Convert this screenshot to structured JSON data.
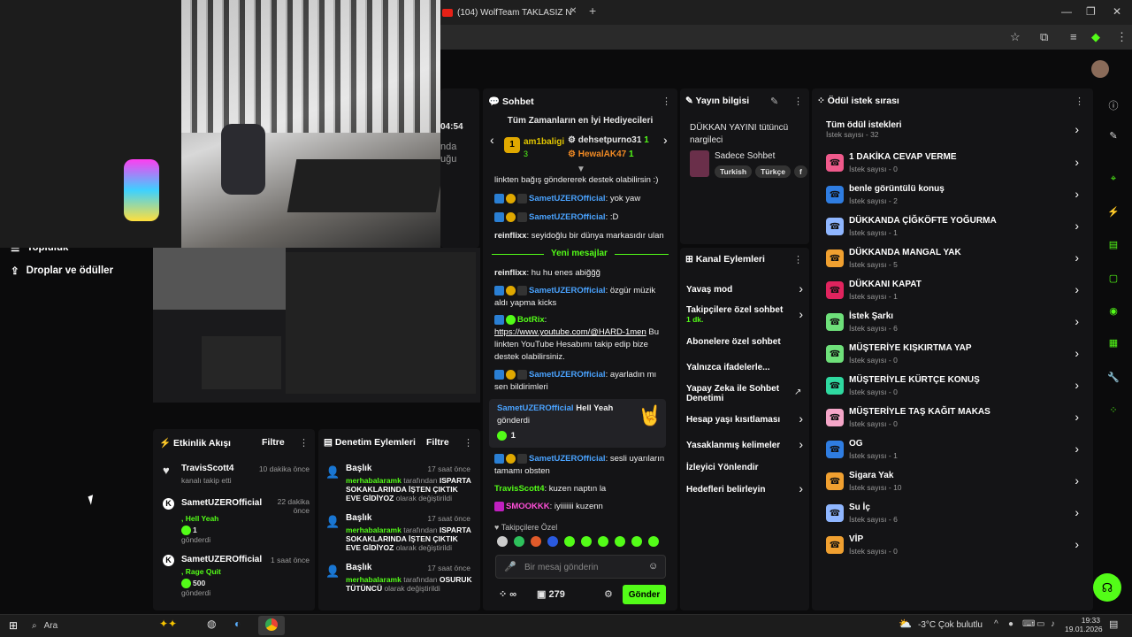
{
  "browser": {
    "tab_title": "(104) WolfTeam TAKLASIZ N",
    "new_tab": "+",
    "close": "✕"
  },
  "left_nav": {
    "items": [
      {
        "label": "Topluluk"
      },
      {
        "label": "Droplar ve ödüller"
      }
    ]
  },
  "partial_panel": {
    "time": "04:54",
    "line1": "nda",
    "line2": "uğu"
  },
  "chat": {
    "title": "Sohbet",
    "leaderboard_title": "Tüm Zamanların en İyi Hediyecileri",
    "leaders": [
      {
        "name": "am1baligi",
        "count": "3"
      },
      {
        "name": "dehsetpurno31",
        "count": "1"
      },
      {
        "name": "HewalAK47",
        "count": "1"
      }
    ],
    "messages_top": [
      {
        "text": "linkten bağış göndererek destek olabilirsin :)"
      },
      {
        "user": "SametUZEROfficial",
        "text": ": yok yaw"
      },
      {
        "user": "SametUZEROfficial",
        "text": ": :D"
      },
      {
        "user": "reinflixx",
        "text": ": seyidoğlu bir dünya markasıdır ulan"
      }
    ],
    "new_messages": "Yeni mesajlar",
    "messages_bottom": [
      {
        "user": "reinflixx",
        "text": ": hu hu enes abiğğğ"
      },
      {
        "user": "SametUZEROfficial",
        "text": ": özgür müzik aldı yapma kicks"
      },
      {
        "user": "BotRix",
        "text": ":"
      },
      {
        "link": "https://www.youtube.com/@HARD-1men",
        "text": " Bu linkten YouTube Hesabımı takip edip bize destek olabilirsiniz."
      },
      {
        "user": "SametUZEROfficial",
        "text": ": ayarladın mı sen bildirimleri"
      }
    ],
    "gift": {
      "user": "SametUZEROfficial",
      "item": "Hell Yeah",
      "sent": "gönderdi",
      "amount": "1"
    },
    "messages_after": [
      {
        "user": "SametUZEROfficial",
        "text": ": sesli uyarıların tamamı obsten"
      },
      {
        "user": "TravisScott4",
        "text": ": kuzen naptın la"
      },
      {
        "user": "SMOOKKK",
        "text": ": iyiiiiiii kuzenn"
      }
    ],
    "followers_only": "Takipçilere Özel",
    "input_placeholder": "Bir mesaj gönderin",
    "viewers": "279",
    "send": "Gönder",
    "infinity": "∞"
  },
  "stream_info": {
    "title": "Yayın bilgisi",
    "stream_title": "DÜKKAN YAYINI tütüncü nargileci",
    "category": "Sadece Sohbet",
    "tags": [
      "Turkish",
      "Türkçe",
      "f"
    ]
  },
  "channel_actions": {
    "title": "Kanal Eylemleri",
    "items": [
      {
        "label": "Yavaş mod",
        "control": "chevron"
      },
      {
        "label": "Takipçilere özel sohbet",
        "sub": "1 dk.",
        "control": "chevron"
      },
      {
        "label": "Abonelere özel sohbet",
        "control": "toggle"
      },
      {
        "label": "Yalnızca ifadelerle...",
        "control": "toggle"
      },
      {
        "label": "Yapay Zeka ile Sohbet Denetimi",
        "control": "external"
      },
      {
        "label": "Hesap yaşı kısıtlaması",
        "control": "chevron"
      },
      {
        "label": "Yasaklanmış kelimeler",
        "control": "chevron"
      },
      {
        "label": "İzleyici Yönlendir",
        "control": "none"
      },
      {
        "label": "Hedefleri belirleyin",
        "control": "chevron"
      }
    ]
  },
  "rewards": {
    "title": "Ödül istek sırası",
    "all_title": "Tüm ödül istekleri",
    "all_sub": "İstek sayısı - 32",
    "items": [
      {
        "title": "1 DAKİKA CEVAP VERME",
        "sub": "İstek sayısı - 0",
        "color": "#f05a8c"
      },
      {
        "title": "benle görüntülü konuş",
        "sub": "İstek sayısı - 2",
        "color": "#2f7de1"
      },
      {
        "title": "DÜKKANDA ÇİĞKÖFTE YOĞURMA",
        "sub": "İstek sayısı - 1",
        "color": "#8fb6ff"
      },
      {
        "title": "DÜKKANDA MANGAL YAK",
        "sub": "İstek sayısı - 5",
        "color": "#f0a030"
      },
      {
        "title": "DÜKKANI KAPAT",
        "sub": "İstek sayısı - 1",
        "color": "#e0245e"
      },
      {
        "title": "İstek Şarkı",
        "sub": "İstek sayısı - 6",
        "color": "#6ee07a"
      },
      {
        "title": "MÜŞTERİYE KIŞKIRTMA YAP",
        "sub": "İstek sayısı - 0",
        "color": "#6ee07a"
      },
      {
        "title": "MÜŞTERİYLE KÜRTÇE KONUŞ",
        "sub": "İstek sayısı - 0",
        "color": "#2fd9a0"
      },
      {
        "title": "MÜŞTERİYLE TAŞ KAĞIT MAKAS",
        "sub": "İstek sayısı - 0",
        "color": "#f5a6c8"
      },
      {
        "title": "OG",
        "sub": "İstek sayısı - 1",
        "color": "#2f7de1"
      },
      {
        "title": "Sigara Yak",
        "sub": "İstek sayısı - 10",
        "color": "#f0a030"
      },
      {
        "title": "Su İç",
        "sub": "İstek sayısı - 6",
        "color": "#8fb6ff"
      },
      {
        "title": "VİP",
        "sub": "İstek sayısı - 0",
        "color": "#f0a030"
      }
    ]
  },
  "activity": {
    "title": "Etkinlik Akışı",
    "filter": "Filtre",
    "items": [
      {
        "user": "TravisScott4",
        "time": "10 dakika önce",
        "desc": "kanalı takip etti"
      },
      {
        "user": "SametUZEROfficial",
        "time": "22 dakika önce",
        "gift": ", Hell Yeah",
        "amount": "1",
        "desc": "gönderdi"
      },
      {
        "user": "SametUZEROfficial",
        "time": "1 saat önce",
        "gift": ", Rage Quit",
        "amount": "500",
        "desc": "gönderdi"
      }
    ]
  },
  "moderation": {
    "title": "Denetim Eylemleri",
    "filter": "Filtre",
    "items": [
      {
        "head": "Başlık",
        "time": "17 saat önce",
        "user": "merhabalaramk",
        "mid": " tarafından ",
        "value": "ISPARTA SOKAKLARINDA İŞTEN ÇIKTIK EVE GİDİYOZ",
        "end": " olarak değiştirildi"
      },
      {
        "head": "Başlık",
        "time": "17 saat önce",
        "user": "merhabalaramk",
        "mid": " tarafından ",
        "value": "ISPARTA SOKAKLARINDA İŞTEN ÇIKTIK EVE GİDİYOZ",
        "end": " olarak değiştirildi"
      },
      {
        "head": "Başlık",
        "time": "17 saat önce",
        "user": "merhabalaramk",
        "mid": " tarafından ",
        "value": "OSURUK TÜTÜNCÜ",
        "end": " olarak değiştirildi"
      }
    ]
  },
  "taskbar": {
    "search": "Ara",
    "weather": "-3°C  Çok bulutlu",
    "time": "19:33",
    "date": "19.01.2026"
  }
}
